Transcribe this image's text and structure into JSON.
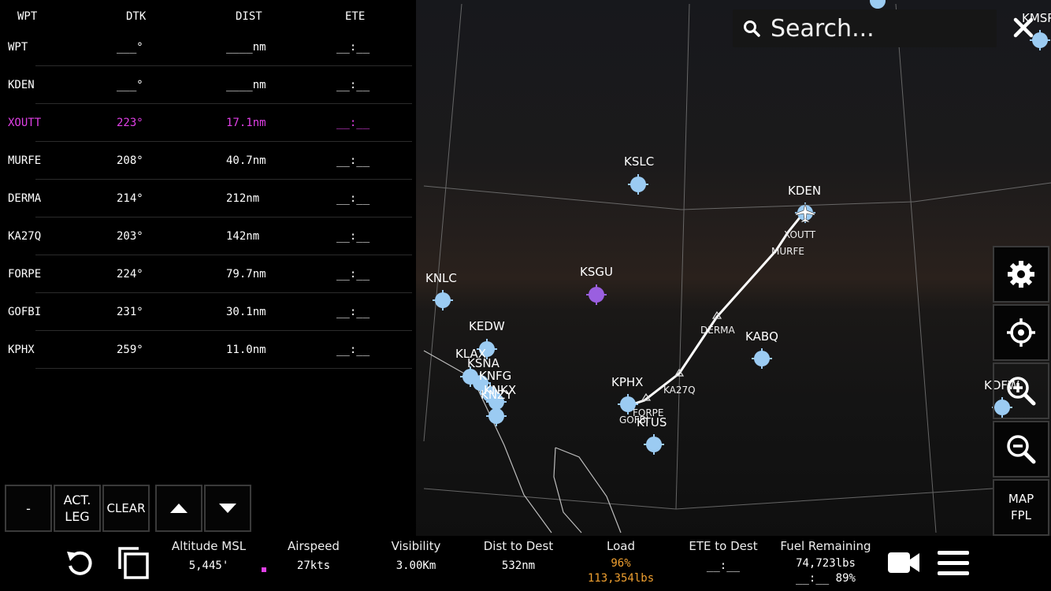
{
  "flight_plan": {
    "headers": {
      "wpt": "WPT",
      "dtk": "DTK",
      "dist": "DIST",
      "ete": "ETE"
    },
    "rows": [
      {
        "wpt": "WPT",
        "dtk": "___°",
        "dist": "____nm",
        "ete": "__:__"
      },
      {
        "wpt": "KDEN",
        "dtk": "___°",
        "dist": "____nm",
        "ete": "__:__"
      },
      {
        "wpt": "XOUTT",
        "dtk": "223°",
        "dist": "17.1nm",
        "ete": "__:__"
      },
      {
        "wpt": "MURFE",
        "dtk": "208°",
        "dist": "40.7nm",
        "ete": "__:__"
      },
      {
        "wpt": "DERMA",
        "dtk": "214°",
        "dist": "212nm",
        "ete": "__:__"
      },
      {
        "wpt": "KA27Q",
        "dtk": "203°",
        "dist": "142nm",
        "ete": "__:__"
      },
      {
        "wpt": "FORPE",
        "dtk": "224°",
        "dist": "79.7nm",
        "ete": "__:__"
      },
      {
        "wpt": "GOFBI",
        "dtk": "231°",
        "dist": "30.1nm",
        "ete": "__:__"
      },
      {
        "wpt": "KPHX",
        "dtk": "259°",
        "dist": "11.0nm",
        "ete": "__:__"
      }
    ],
    "active_row": 2,
    "active_color": "#e040e6",
    "buttons": {
      "minus": "-",
      "act_leg": "ACT.\nLEG",
      "clear": "CLEAR"
    }
  },
  "search": {
    "placeholder": "Search..."
  },
  "map": {
    "airports": [
      {
        "id": "KSLC"
      },
      {
        "id": "KDEN"
      },
      {
        "id": "KNLC"
      },
      {
        "id": "KSGU",
        "color": "#9a5fe0"
      },
      {
        "id": "KEDW"
      },
      {
        "id": "KLAX"
      },
      {
        "id": "KSNA"
      },
      {
        "id": "KNFG"
      },
      {
        "id": "KNKX"
      },
      {
        "id": "KNZY"
      },
      {
        "id": "KPHX"
      },
      {
        "id": "KABQ"
      },
      {
        "id": "KTUS"
      },
      {
        "id": "KDFW"
      },
      {
        "id": "KMSP"
      }
    ],
    "airport_color": "#9bcbf2",
    "route_labels": {
      "xoutt": "XOUTT",
      "murfe": "MURFE",
      "derma": "DERMA",
      "ka27q": "KA27Q",
      "forpe": "FORPE",
      "gofbi": "GOFBI"
    },
    "map_fpl_label": "MAP\nFPL"
  },
  "status": {
    "altitude": {
      "label": "Altitude MSL",
      "value": "5,445'"
    },
    "airspeed": {
      "label": "Airspeed",
      "value": "27kts"
    },
    "visibility": {
      "label": "Visibility",
      "value": "3.00Km"
    },
    "dist_to_dest": {
      "label": "Dist to Dest",
      "value": "532nm"
    },
    "load": {
      "label": "Load",
      "percent": "96%",
      "weight": "113,354lbs",
      "color": "#f0a030"
    },
    "ete_to_dest": {
      "label": "ETE to Dest",
      "value": "__:__"
    },
    "fuel": {
      "label": "Fuel Remaining",
      "weight": "74,723lbs",
      "time": "__:__",
      "percent": "89%"
    },
    "airspeed_marker_color": "#e040e6"
  },
  "icons": [
    "search-icon",
    "close-icon",
    "gear-icon",
    "crosshair-icon",
    "zoom-in-icon",
    "zoom-out-icon",
    "undo-icon",
    "copy-icon",
    "camera-icon",
    "menu-icon",
    "arrow-up-icon",
    "arrow-down-icon"
  ]
}
